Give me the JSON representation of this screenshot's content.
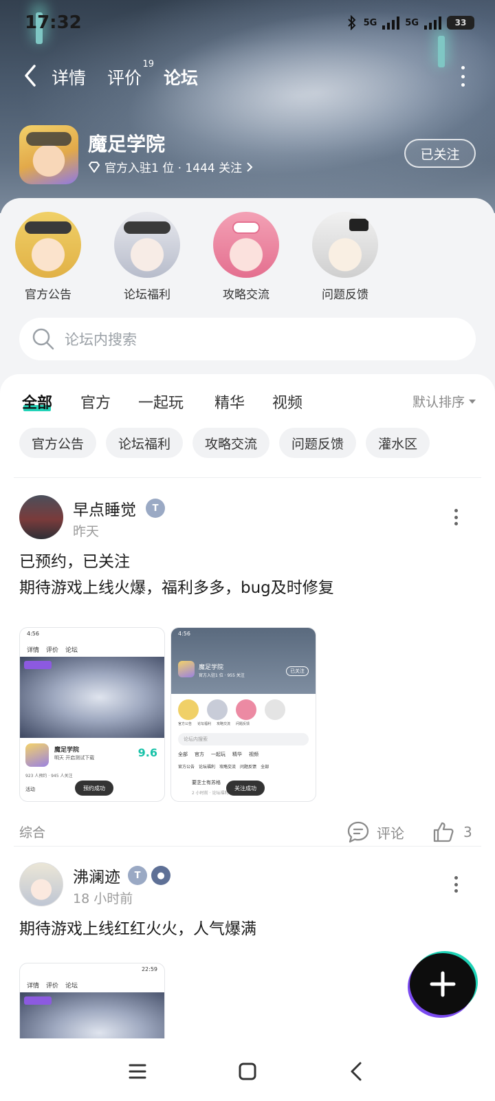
{
  "status_bar": {
    "time": "17:32",
    "net1": "5G",
    "net2": "5G",
    "battery": "33"
  },
  "nav": {
    "tabs": [
      {
        "label": "详情"
      },
      {
        "label": "评价",
        "count": "19"
      },
      {
        "label": "论坛",
        "active": true
      }
    ]
  },
  "game": {
    "name": "魔足学院",
    "meta": "官方入驻1 位 · 1444 关注",
    "follow_label": "已关注"
  },
  "boards": [
    {
      "label": "官方公告"
    },
    {
      "label": "论坛福利"
    },
    {
      "label": "攻略交流"
    },
    {
      "label": "问题反馈"
    }
  ],
  "search": {
    "placeholder": "论坛内搜索"
  },
  "filters": {
    "tabs": [
      "全部",
      "官方",
      "一起玩",
      "精华",
      "视频"
    ],
    "sort_label": "默认排序"
  },
  "chips": [
    "官方公告",
    "论坛福利",
    "攻略交流",
    "问题反馈",
    "灌水区"
  ],
  "posts": [
    {
      "username": "早点睡觉",
      "time": "昨天",
      "line1": "已预约，已关注",
      "line2": "期待游戏上线火爆，福利多多，bug及时修复",
      "tag": "综合",
      "comment_label": "评论",
      "like_count": "3",
      "shot1": {
        "time": "4:56",
        "tabs": [
          "详情",
          "评价",
          "论坛"
        ],
        "name": "魔足学院",
        "desc": "明天 开启测试下载",
        "score": "9.6",
        "stats": "923 人预约 · 945 人关注",
        "activity": "活动",
        "toast": "预约成功"
      },
      "shot2": {
        "time": "4:56",
        "name": "魔足学院",
        "meta": "官方入驻1 位 · 955 关注",
        "follow": "已关注",
        "boards": [
          "官方公告",
          "论坛福利",
          "攻略交流",
          "问题反馈"
        ],
        "search": "论坛内搜索",
        "tabs": [
          "全部",
          "官方",
          "一起玩",
          "精华",
          "视频"
        ],
        "chips": [
          "官方公告",
          "论坛福利",
          "攻略交流",
          "问题反馈",
          "全部"
        ],
        "user": "要芝士有苏格",
        "time_ago": "2 小时前 · 论坛福利",
        "toast": "关注成功"
      }
    },
    {
      "username": "沸澜迹",
      "time": "18 小时前",
      "line1": "期待游戏上线红红火火，人气爆满",
      "shot1": {
        "time": "22:59",
        "tabs": [
          "详情",
          "评价",
          "论坛"
        ]
      }
    }
  ],
  "fab": {
    "icon": "plus-icon"
  },
  "bottom_nav": {
    "icons": [
      "menu-icon",
      "home-icon",
      "back-icon"
    ]
  },
  "colors": {
    "accent": "#22d3b8",
    "score": "#18c2a8"
  }
}
